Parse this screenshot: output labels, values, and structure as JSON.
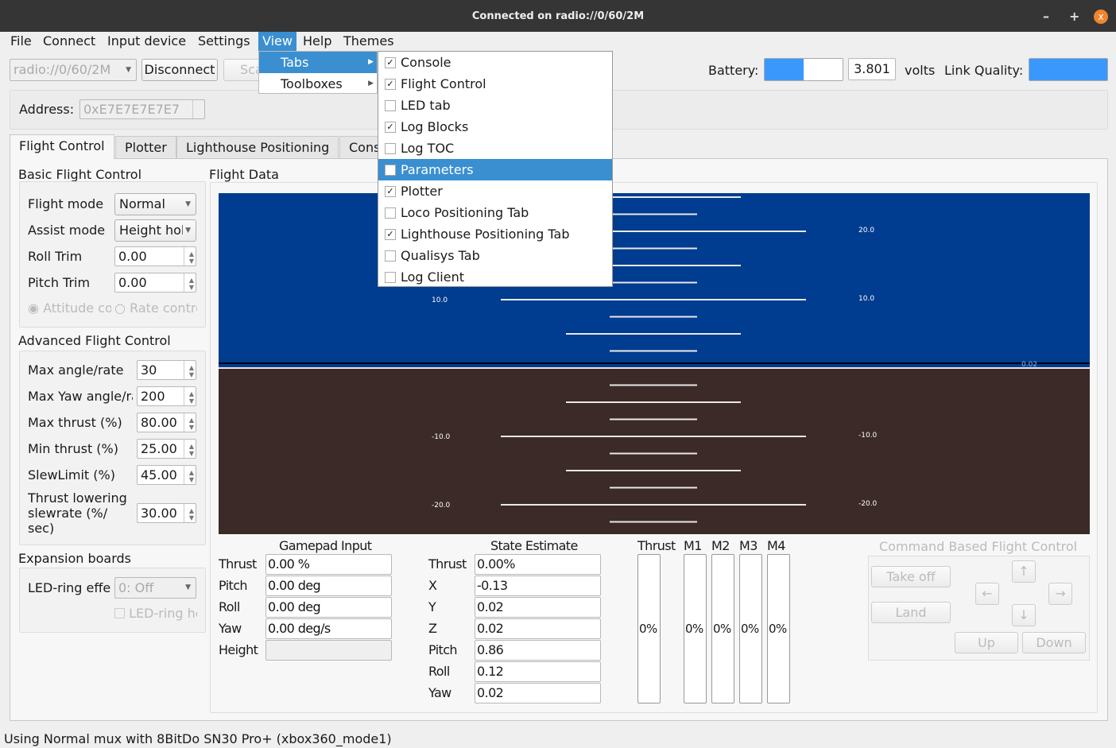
{
  "window": {
    "title": "Connected on radio://0/60/2M",
    "minimize": "–",
    "maximize": "+",
    "close": "x"
  },
  "menubar": [
    "File",
    "Connect",
    "Input device",
    "Settings",
    "View",
    "Help",
    "Themes"
  ],
  "view_menu": {
    "items": [
      "Tabs",
      "Toolboxes"
    ]
  },
  "tabs_menu": [
    {
      "label": "Console",
      "checked": true
    },
    {
      "label": "Flight Control",
      "checked": true
    },
    {
      "label": "LED tab",
      "checked": false
    },
    {
      "label": "Log Blocks",
      "checked": true
    },
    {
      "label": "Log TOC",
      "checked": false
    },
    {
      "label": "Parameters",
      "checked": false,
      "highlighted": true
    },
    {
      "label": "Plotter",
      "checked": true
    },
    {
      "label": "Loco Positioning Tab",
      "checked": false
    },
    {
      "label": "Lighthouse Positioning Tab",
      "checked": true
    },
    {
      "label": "Qualisys Tab",
      "checked": false
    },
    {
      "label": "Log Client",
      "checked": false
    }
  ],
  "toolbar": {
    "uri": "radio://0/60/2M",
    "disconnect": "Disconnect",
    "scan": "Scan",
    "battery_label": "Battery:",
    "battery_level_percent": 50,
    "voltage": "3.801",
    "volts": "volts",
    "link_label": "Link Quality:",
    "link_quality_percent": 100,
    "address_label": "Address:",
    "address": "0xE7E7E7E7E7"
  },
  "tabs": [
    "Flight Control",
    "Plotter",
    "Lighthouse Positioning",
    "Console"
  ],
  "basic": {
    "title": "Basic Flight Control",
    "flight_mode_label": "Flight mode",
    "flight_mode": "Normal",
    "assist_mode_label": "Assist mode",
    "assist_mode": "Height hold",
    "roll_trim_label": "Roll Trim",
    "roll_trim": "0.00",
    "pitch_trim_label": "Pitch Trim",
    "pitch_trim": "0.00",
    "attitude": "Attitude control",
    "rate": "Rate control"
  },
  "advanced": {
    "title": "Advanced Flight Control",
    "rows": [
      {
        "label": "Max angle/rate",
        "value": "30"
      },
      {
        "label": "Max Yaw angle/rate",
        "value": "200"
      },
      {
        "label": "Max thrust (%)",
        "value": "80.00"
      },
      {
        "label": "Min thrust (%)",
        "value": "25.00"
      },
      {
        "label": "SlewLimit (%)",
        "value": "45.00"
      },
      {
        "label": "Thrust lowering slewrate (%/ sec)",
        "value": "30.00"
      }
    ]
  },
  "expansion": {
    "title": "Expansion boards",
    "led_label": "LED-ring effect",
    "led_value": "0: Off",
    "led_headlight": "LED-ring headlight"
  },
  "flight_data": {
    "title": "Flight Data",
    "ladder_labels_left": [
      "10.0",
      "-10.0",
      "-20.0"
    ],
    "ladder_labels_right": [
      "20.0",
      "10.0",
      "-10.0",
      "-20.0"
    ],
    "altitude": "0.02",
    "colors": {
      "sky": "#003c8f",
      "ground": "#3c2a28"
    }
  },
  "gamepad": {
    "title": "Gamepad Input",
    "rows": [
      {
        "label": "Thrust",
        "value": "0.00 %"
      },
      {
        "label": "Pitch",
        "value": "0.00 deg"
      },
      {
        "label": "Roll",
        "value": "0.00 deg"
      },
      {
        "label": "Yaw",
        "value": "0.00 deg/s"
      },
      {
        "label": "Height",
        "value": ""
      }
    ]
  },
  "state": {
    "title": "State Estimate",
    "rows": [
      {
        "label": "Thrust",
        "value": "0.00%"
      },
      {
        "label": "X",
        "value": "-0.13"
      },
      {
        "label": "Y",
        "value": "0.02"
      },
      {
        "label": "Z",
        "value": "0.02"
      },
      {
        "label": "Pitch",
        "value": "0.86"
      },
      {
        "label": "Roll",
        "value": "0.12"
      },
      {
        "label": "Yaw",
        "value": "0.02"
      }
    ]
  },
  "motors": [
    {
      "label": "Thrust",
      "value": "0%"
    },
    {
      "label": "M1",
      "value": "0%"
    },
    {
      "label": "M2",
      "value": "0%"
    },
    {
      "label": "M3",
      "value": "0%"
    },
    {
      "label": "M4",
      "value": "0%"
    }
  ],
  "command": {
    "title": "Command Based Flight Control",
    "takeoff": "Take off",
    "land": "Land",
    "up": "Up",
    "down": "Down",
    "fwd": "↑",
    "back": "↓",
    "left": "←",
    "right": "→"
  },
  "status": "Using Normal mux with 8BitDo SN30 Pro+ (xbox360_mode1)"
}
